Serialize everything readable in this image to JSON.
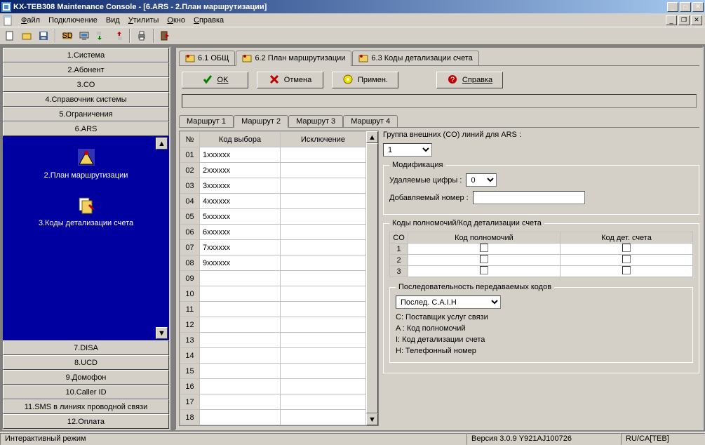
{
  "window": {
    "title": "KX-TEB308 Maintenance Console - [6.ARS - 2.План маршрутизации]"
  },
  "menu": {
    "file": "Файл",
    "conn": "Подключение",
    "view": "Вид",
    "util": "Утилиты",
    "window": "Окно",
    "help": "Справка"
  },
  "sidebar": {
    "items": [
      "1.Система",
      "2.Абонент",
      "3.CO",
      "4.Справочник системы",
      "5.Ограничения",
      "6.ARS",
      "7.DISA",
      "8.UCD",
      "9.Домофон",
      "10.Caller ID",
      "11.SMS в линиях проводной связи",
      "12.Оплата"
    ],
    "nav": [
      {
        "label": "2.План маршрутизации"
      },
      {
        "label": "3.Коды детализации счета"
      }
    ]
  },
  "tabs": {
    "upper": [
      {
        "label": "6.1 ОБЩ"
      },
      {
        "label": "6.2 План маршрутизации"
      },
      {
        "label": "6.3 Коды детализации счета"
      }
    ],
    "buttons": {
      "ok": "OK",
      "cancel": "Отмена",
      "apply": "Примен.",
      "help": "Справка"
    },
    "routes": [
      "Маршрут 1",
      "Маршрут 2",
      "Маршрут 3",
      "Маршрут 4"
    ]
  },
  "grid": {
    "headers": {
      "no": "№",
      "sel": "Код выбора",
      "exc": "Исключение"
    },
    "rows": [
      {
        "no": "01",
        "val": "1xxxxxx"
      },
      {
        "no": "02",
        "val": "2xxxxxx"
      },
      {
        "no": "03",
        "val": "3xxxxxx"
      },
      {
        "no": "04",
        "val": "4xxxxxx"
      },
      {
        "no": "05",
        "val": "5xxxxxx"
      },
      {
        "no": "06",
        "val": "6xxxxxx"
      },
      {
        "no": "07",
        "val": "7xxxxxx"
      },
      {
        "no": "08",
        "val": "9xxxxxx"
      },
      {
        "no": "09",
        "val": ""
      },
      {
        "no": "10",
        "val": ""
      },
      {
        "no": "11",
        "val": ""
      },
      {
        "no": "12",
        "val": ""
      },
      {
        "no": "13",
        "val": ""
      },
      {
        "no": "14",
        "val": ""
      },
      {
        "no": "15",
        "val": ""
      },
      {
        "no": "16",
        "val": ""
      },
      {
        "no": "17",
        "val": ""
      },
      {
        "no": "18",
        "val": ""
      }
    ]
  },
  "settings": {
    "group_label": "Группа внешних (CO) линий для ARS   :",
    "group_value": "1",
    "mod_legend": "Модификация",
    "del_digits_label": "Удаляемые цифры :",
    "del_digits_value": "0",
    "add_num_label": "Добавляемый номер :",
    "add_num_value": "",
    "codes_legend": "Коды полномочий/Код детализации счета",
    "col_co": "CO",
    "col_auth": "Код полномочий",
    "col_det": "Код дет. счета",
    "rows": [
      "1",
      "2",
      "3"
    ],
    "seq_legend": "Последовательность передаваемых кодов",
    "seq_value": "Послед. C.A.I.H",
    "seq_lines": [
      "C: Поставщик услуг связи",
      "A : Код полномочий",
      "I: Код детализации счета",
      "H: Телефонный номер"
    ]
  },
  "statusbar": {
    "mode": "Интерактивный режим",
    "version": "Версия 3.0.9 Y921AJ100726",
    "locale": "RU/CA[TEB]"
  }
}
